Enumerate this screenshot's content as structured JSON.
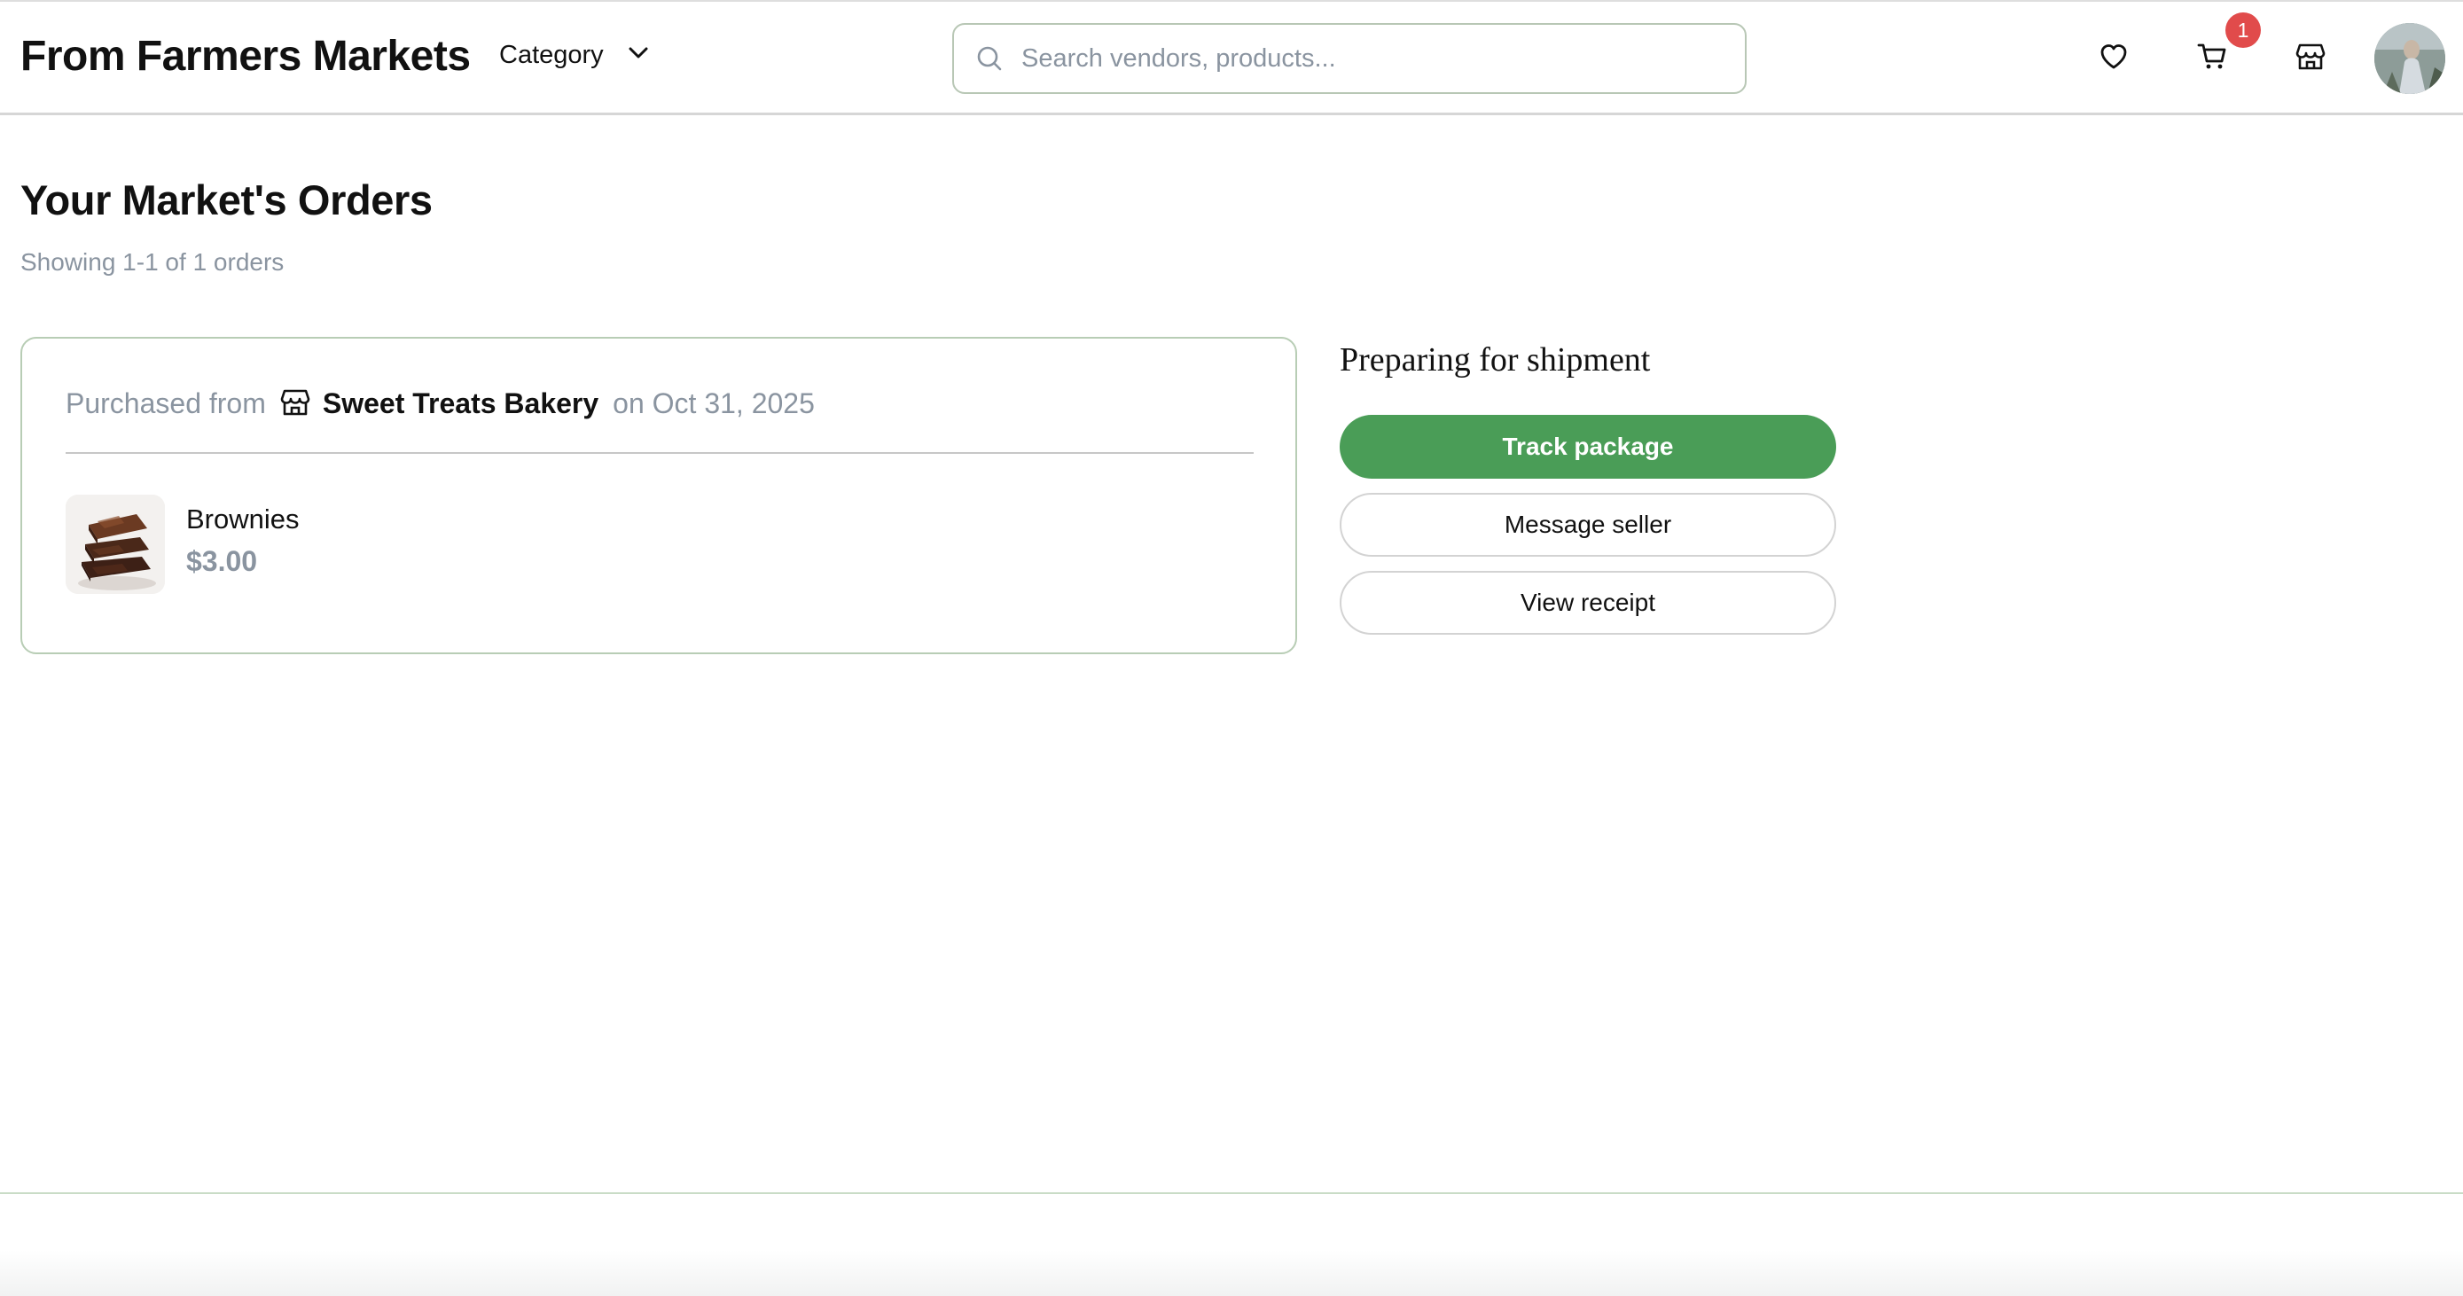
{
  "header": {
    "brand": "From Farmers Markets",
    "category_label": "Category",
    "search_placeholder": "Search vendors, products...",
    "cart_count": "1",
    "icons": [
      "search-icon",
      "heart-icon",
      "cart-icon",
      "store-icon",
      "chevron-down-icon"
    ]
  },
  "main": {
    "title": "Your Market's Orders",
    "count_text": "Showing 1-1 of 1 orders"
  },
  "order": {
    "purchased_from_label": "Purchased from",
    "vendor": "Sweet Treats Bakery",
    "date_text": "on Oct 31, 2025",
    "item": {
      "name": "Brownies",
      "price": "$3.00"
    },
    "status": "Preparing for shipment",
    "actions": {
      "track": "Track package",
      "message": "Message seller",
      "receipt": "View receipt"
    }
  },
  "colors": {
    "primary_green": "#4a9d57",
    "badge_red": "#e14b4b",
    "muted_text": "#8a94a0",
    "card_border": "#b8cdb5"
  }
}
